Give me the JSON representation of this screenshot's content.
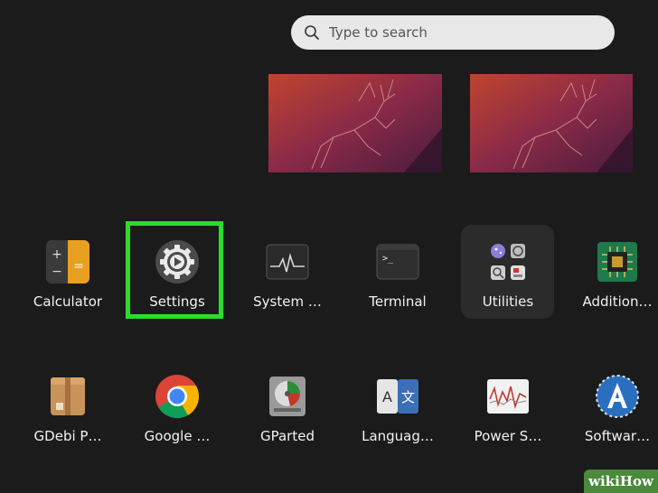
{
  "search": {
    "placeholder": "Type to search",
    "icon": "search-icon"
  },
  "workspaces": [
    {
      "name": "workspace-1"
    },
    {
      "name": "workspace-2"
    }
  ],
  "apps_row1": [
    {
      "label": "Calculator",
      "icon": "calculator-icon"
    },
    {
      "label": "Settings",
      "icon": "settings-gear-icon"
    },
    {
      "label": "System …",
      "icon": "system-monitor-icon"
    },
    {
      "label": "Terminal",
      "icon": "terminal-icon"
    },
    {
      "label": "Utilities",
      "icon": "utilities-folder-icon"
    },
    {
      "label": "Addition…",
      "icon": "additional-drivers-icon"
    }
  ],
  "apps_row2": [
    {
      "label": "GDebi P…",
      "icon": "gdebi-package-icon"
    },
    {
      "label": "Google …",
      "icon": "google-chrome-icon"
    },
    {
      "label": "GParted",
      "icon": "gparted-icon"
    },
    {
      "label": "Languag…",
      "icon": "language-support-icon"
    },
    {
      "label": "Power S…",
      "icon": "power-statistics-icon"
    },
    {
      "label": "Softwar…",
      "icon": "software-updater-icon"
    }
  ],
  "highlight_color": "#2bdc2b",
  "watermark": {
    "part1": "wiki",
    "part2": "How"
  }
}
